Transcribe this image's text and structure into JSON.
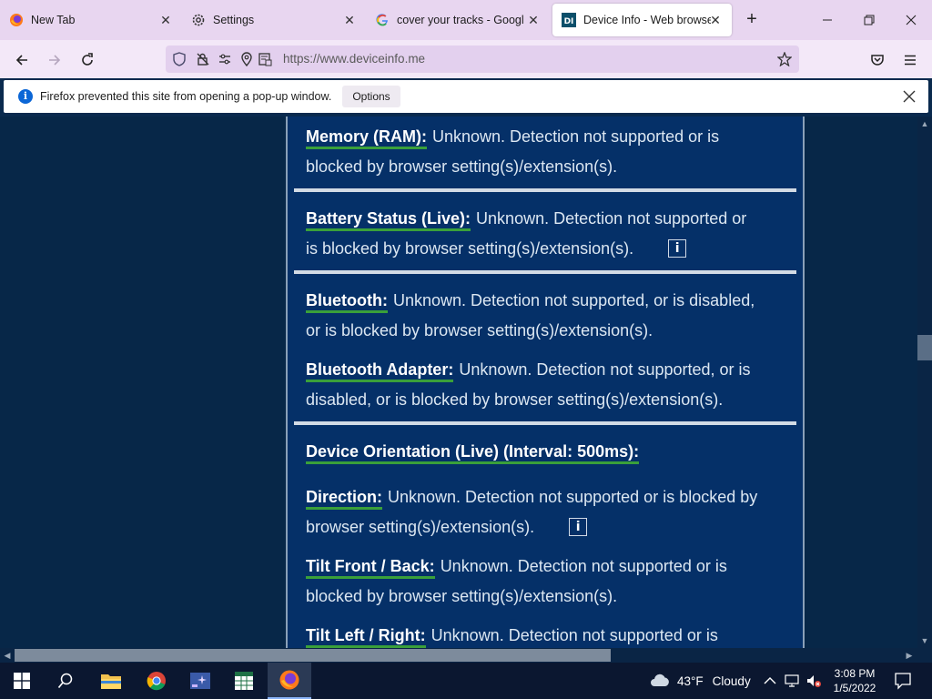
{
  "browser": {
    "tabs": [
      {
        "label": "New Tab",
        "icon": "firefox-icon"
      },
      {
        "label": "Settings",
        "icon": "gear-icon"
      },
      {
        "label": "cover your tracks - Google",
        "icon": "google-icon"
      },
      {
        "label": "Device Info - Web browser",
        "icon": "deviceinfo-icon",
        "active": true
      }
    ],
    "url": "https://www.deviceinfo.me",
    "notification": {
      "message": "Firefox prevented this site from opening a pop-up window.",
      "options_label": "Options"
    }
  },
  "content": {
    "entries": [
      {
        "label": "Memory (RAM):",
        "value": "Unknown. Detection not supported or is",
        "value2": "blocked by browser setting(s)/extension(s)."
      },
      {
        "label": "Battery Status (Live):",
        "value": "Unknown. Detection not supported or",
        "value2": "is blocked by browser setting(s)/extension(s).",
        "info": "i"
      },
      {
        "label": "Bluetooth:",
        "value": "Unknown. Detection not supported, or is disabled,",
        "value2": "or is blocked by browser setting(s)/extension(s)."
      },
      {
        "label": "Bluetooth Adapter:",
        "value": "Unknown. Detection not supported, or is",
        "value2": "disabled, or is blocked by browser setting(s)/extension(s)."
      },
      {
        "label": "Device Orientation (Live) (Interval: 500ms):"
      },
      {
        "label": "Direction:",
        "value": "Unknown. Detection not supported or is blocked by",
        "value2": "browser setting(s)/extension(s).",
        "info": "i"
      },
      {
        "label": "Tilt Front / Back:",
        "value": "Unknown. Detection not supported or is",
        "value2": "blocked by browser setting(s)/extension(s)."
      },
      {
        "label": "Tilt Left / Right:",
        "value": "Unknown. Detection not supported or is"
      }
    ]
  },
  "taskbar": {
    "weather": {
      "temp": "43°F",
      "condition": "Cloudy"
    },
    "clock": {
      "time": "3:08 PM",
      "date": "1/5/2022"
    }
  },
  "colors": {
    "page_bg": "#072748",
    "panel_bg": "#053068",
    "label_underline": "#3aa03a",
    "tabstrip": "#e8d6f0"
  }
}
